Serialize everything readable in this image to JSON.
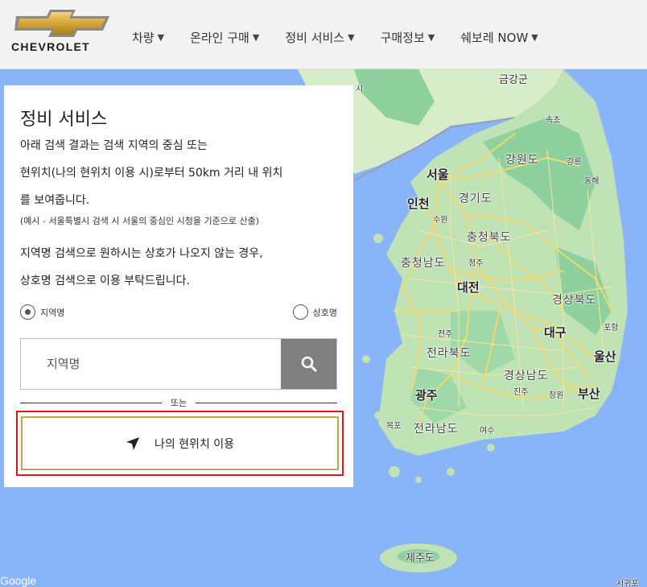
{
  "brand": {
    "name": "CHEVROLET"
  },
  "nav": {
    "items": [
      {
        "label": "차량"
      },
      {
        "label": "온라인 구매"
      },
      {
        "label": "정비 서비스"
      },
      {
        "label": "구매정보"
      },
      {
        "label": "쉐보레 NOW"
      }
    ],
    "caret": "▼"
  },
  "panel": {
    "title": "정비 서비스",
    "desc_line1": "아래 검색 결과는 검색 지역의 중심 또는",
    "desc_line2": "현위치(나의 현위치 이용 시)로부터 50km 거리 내 위치",
    "desc_line3": "를 보여줍니다.",
    "note": "(예시 - 서울특별시 검색 시 서울의 중심인 시청을 기준으로 산출)",
    "desc2_line1": "지역명 검색으로 원하시는 상호가 나오지 않는 경우,",
    "desc2_line2": "상호명 검색으로 이용 부탁드립니다.",
    "radio_region": "지역명",
    "radio_business": "상호명",
    "selected_radio": "지역명",
    "search_placeholder": "지역명",
    "or_label": "또는",
    "location_button": "나의 현위치 이용"
  },
  "map": {
    "labels": {
      "geumgang": "금강군",
      "sokcho": "속초",
      "gangwon": "강원도",
      "gangneung": "강릉",
      "donghae": "동해",
      "seoul": "서울",
      "incheon": "인천",
      "gyeonggi": "경기도",
      "suwon": "수원",
      "chungbuk": "충청북도",
      "chungnam": "충청남도",
      "cheongju": "청주",
      "daejeon": "대전",
      "gyeongbuk": "경상북도",
      "pohang": "포항",
      "daegu": "대구",
      "jeonju": "전주",
      "jeonbuk": "전라북도",
      "ulsan": "울산",
      "gyeongnam": "경상남도",
      "gwangju": "광주",
      "jinju": "진주",
      "changwon": "창원",
      "busan": "부산",
      "mokpo": "목포",
      "jeonnam": "전라남도",
      "yeosu": "여수",
      "jeju": "제주도",
      "partial_top": "시",
      "partial_bottom": "서귀포"
    },
    "google": "Google",
    "colors": {
      "sea": "#8ab4f8",
      "land": "#bfe3b4",
      "forest": "#8fd19e",
      "road": "#f5d76e"
    }
  }
}
